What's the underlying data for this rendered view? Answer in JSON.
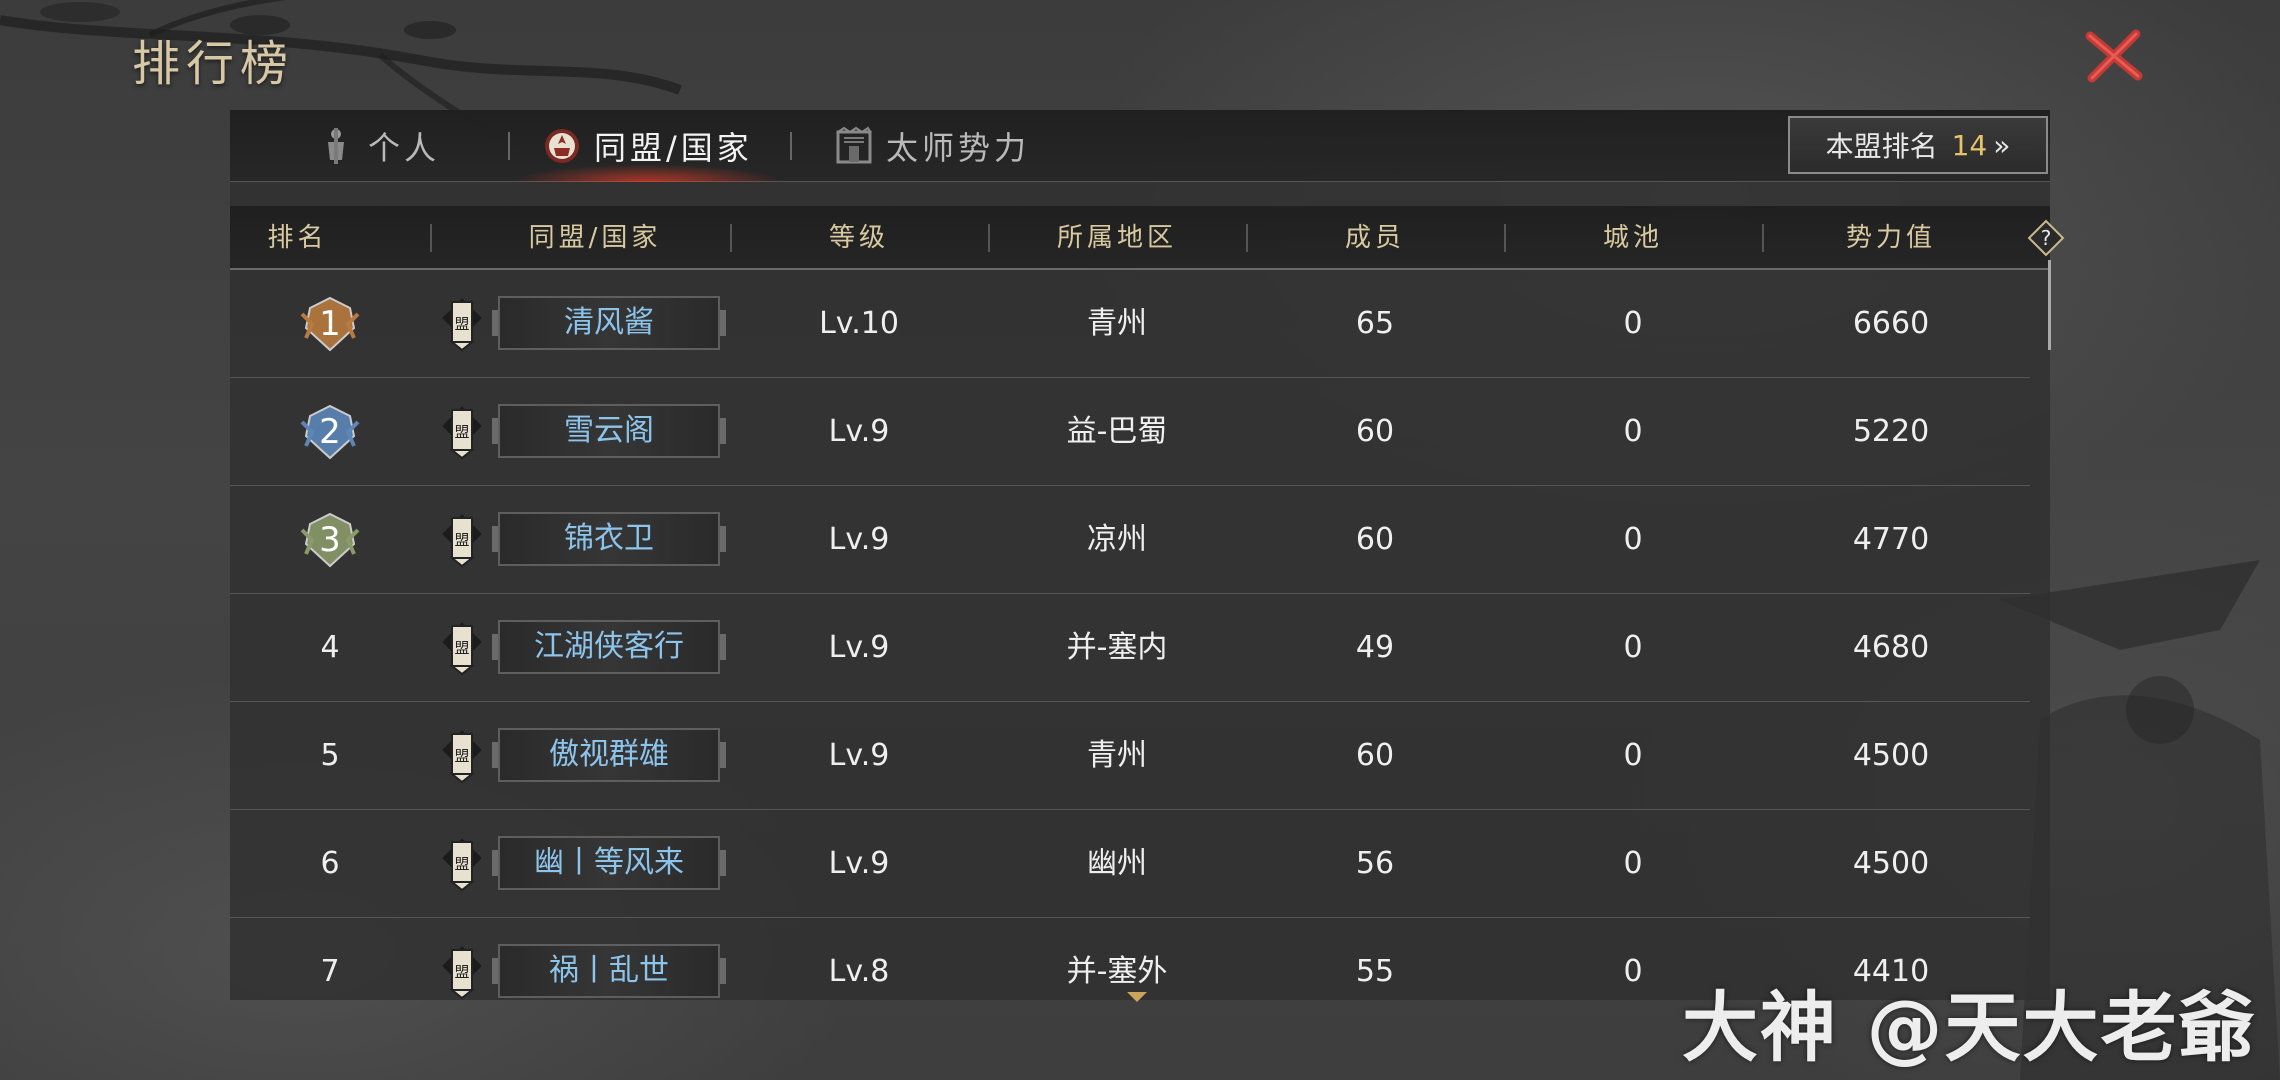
{
  "page_title": "排行榜",
  "tabs": [
    {
      "label": "个人",
      "icon": "person-icon",
      "active": false
    },
    {
      "label": "同盟/国家",
      "icon": "alliance-icon",
      "active": true
    },
    {
      "label": "太师势力",
      "icon": "castle-icon",
      "active": false
    }
  ],
  "my_rank": {
    "label": "本盟排名",
    "value": "14",
    "arrow": "»"
  },
  "columns": [
    "排名",
    "同盟/国家",
    "等级",
    "所属地区",
    "成员",
    "城池",
    "势力值"
  ],
  "help_symbol": "?",
  "flag_char": "盟",
  "rows": [
    {
      "rank": "1",
      "name": "清风酱",
      "level": "Lv.10",
      "region": "青州",
      "members": "65",
      "cities": "0",
      "power": "6660"
    },
    {
      "rank": "2",
      "name": "雪云阁",
      "level": "Lv.9",
      "region": "益-巴蜀",
      "members": "60",
      "cities": "0",
      "power": "5220"
    },
    {
      "rank": "3",
      "name": "锦衣卫",
      "level": "Lv.9",
      "region": "凉州",
      "members": "60",
      "cities": "0",
      "power": "4770"
    },
    {
      "rank": "4",
      "name": "江湖侠客行",
      "level": "Lv.9",
      "region": "并-塞内",
      "members": "49",
      "cities": "0",
      "power": "4680"
    },
    {
      "rank": "5",
      "name": "傲视群雄",
      "level": "Lv.9",
      "region": "青州",
      "members": "60",
      "cities": "0",
      "power": "4500"
    },
    {
      "rank": "6",
      "name": "幽丨等风来",
      "level": "Lv.9",
      "region": "幽州",
      "members": "56",
      "cities": "0",
      "power": "4500"
    },
    {
      "rank": "7",
      "name": "祸丨乱世",
      "level": "Lv.8",
      "region": "并-塞外",
      "members": "55",
      "cities": "0",
      "power": "4410"
    }
  ],
  "watermark": "大神 @天大老爺",
  "colors": {
    "gold": "#d9c9a0",
    "alliance_name": "#8cc4ec",
    "close": "#c43a36",
    "rank1": "#b87a3e",
    "rank2": "#5c86b8",
    "rank3": "#8a9a6a"
  }
}
